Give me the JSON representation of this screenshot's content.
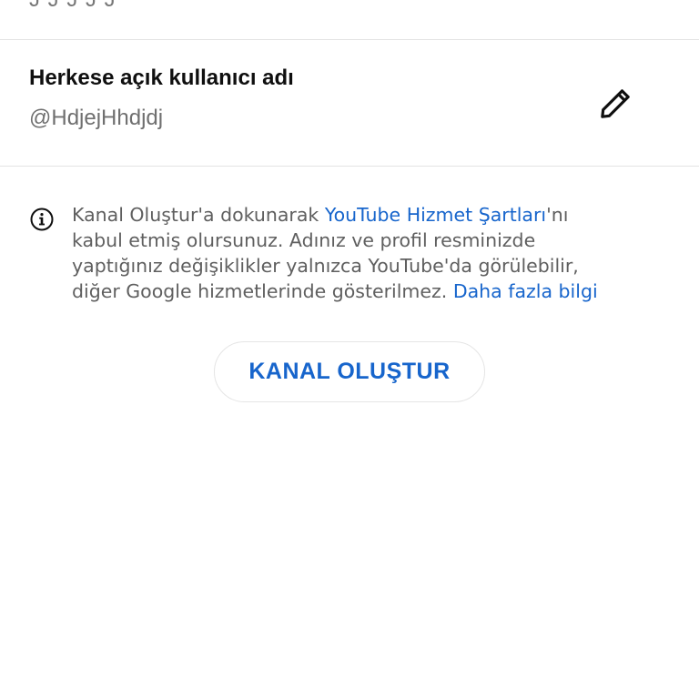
{
  "top_partial": {
    "text": "J J J J J"
  },
  "username_section": {
    "label": "Herkese açık kullanıcı adı",
    "value": "@HdjejHhdjdj",
    "edit_icon": "pencil-icon"
  },
  "terms_notice": {
    "icon": "info-icon",
    "text_before": "Kanal Oluştur'a dokunarak ",
    "terms_link": "YouTube Hizmet Şartları",
    "text_middle": "'nı\nkabul etmiş olursunuz. Adınız ve profil resminizde\nyaptığınız değişiklikler yalnızca YouTube'da görülebilir,\ndiğer Google hizmetlerinde gösterilmez. ",
    "learn_more_link": "Daha fazla bilgi"
  },
  "create_channel_button": {
    "label": "KANAL OLUŞTUR"
  },
  "colors": {
    "link": "#1765cc",
    "primary_text": "#0f0f0f",
    "secondary_text": "#5f5f5f",
    "divider": "#e3e3e3"
  }
}
